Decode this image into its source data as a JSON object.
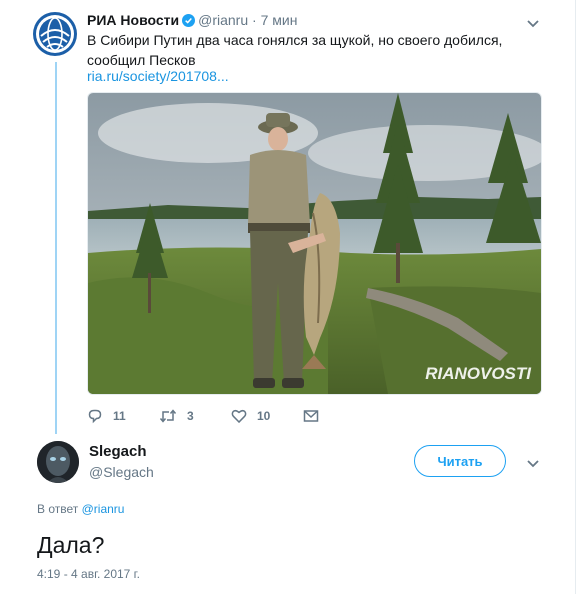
{
  "original_tweet": {
    "name": "РИА Новости",
    "handle": "@rianru",
    "separator": "·",
    "time": "7 мин",
    "text": "В Сибири Путин два часа гонялся за щукой, но своего добился, сообщил Песков",
    "link": "ria.ru/society/201708...",
    "photo_watermark": "RIANOVOSTI",
    "actions": {
      "reply_count": "11",
      "retweet_count": "3",
      "like_count": "10"
    }
  },
  "reply_tweet": {
    "name": "Slegach",
    "handle": "@Slegach",
    "follow_label": "Читать",
    "reply_prefix": "В ответ",
    "reply_to": "@rianru",
    "text": "Дала?",
    "timestamp": "4:19 - 4 авг. 2017 г."
  },
  "icons": {
    "verified": "verified-badge-icon",
    "caret": "chevron-down-icon",
    "reply": "reply-icon",
    "retweet": "retweet-icon",
    "like": "heart-icon",
    "dm": "envelope-icon"
  },
  "colors": {
    "link": "#1b95e0",
    "accent": "#1da1f2",
    "muted": "#657786",
    "thread_line": "#9fd4f5"
  }
}
